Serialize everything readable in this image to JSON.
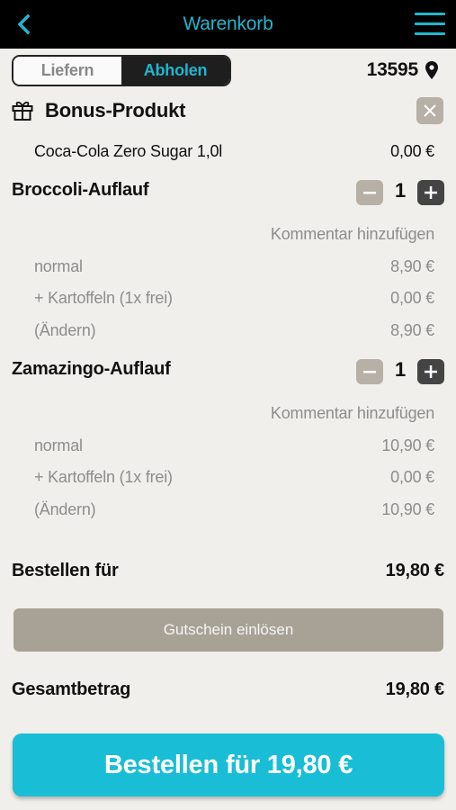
{
  "header": {
    "title": "Warenkorb"
  },
  "mode": {
    "deliver": "Liefern",
    "pickup": "Abholen",
    "selected": "pickup"
  },
  "postal_code": "13595",
  "bonus": {
    "title": "Bonus-Produkt",
    "item_name": "Coca-Cola Zero Sugar 1,0l",
    "item_price": "0,00 €"
  },
  "items": [
    {
      "name": "Broccoli-Auflauf",
      "quantity": "1",
      "comment_label": "Kommentar hinzufügen",
      "variant": "normal",
      "variant_price": "8,90 €",
      "extra": "+ Kartoffeln (1x frei)",
      "extra_price": "0,00 €",
      "change": "(Ändern)",
      "total": "8,90 €"
    },
    {
      "name": "Zamazingo-Auflauf",
      "quantity": "1",
      "comment_label": "Kommentar hinzufügen",
      "variant": "normal",
      "variant_price": "10,90 €",
      "extra": "+ Kartoffeln (1x frei)",
      "extra_price": "0,00 €",
      "change": "(Ändern)",
      "total": "10,90 €"
    }
  ],
  "subtotal": {
    "label": "Bestellen für",
    "value": "19,80 €"
  },
  "voucher_label": "Gutschein einlösen",
  "total": {
    "label": "Gesamtbetrag",
    "value": "19,80 €"
  },
  "order_button": "Bestellen für 19,80 €",
  "colors": {
    "accent": "#1fb6cf",
    "button": "#19bdd6",
    "muted_button": "#a8a296"
  }
}
